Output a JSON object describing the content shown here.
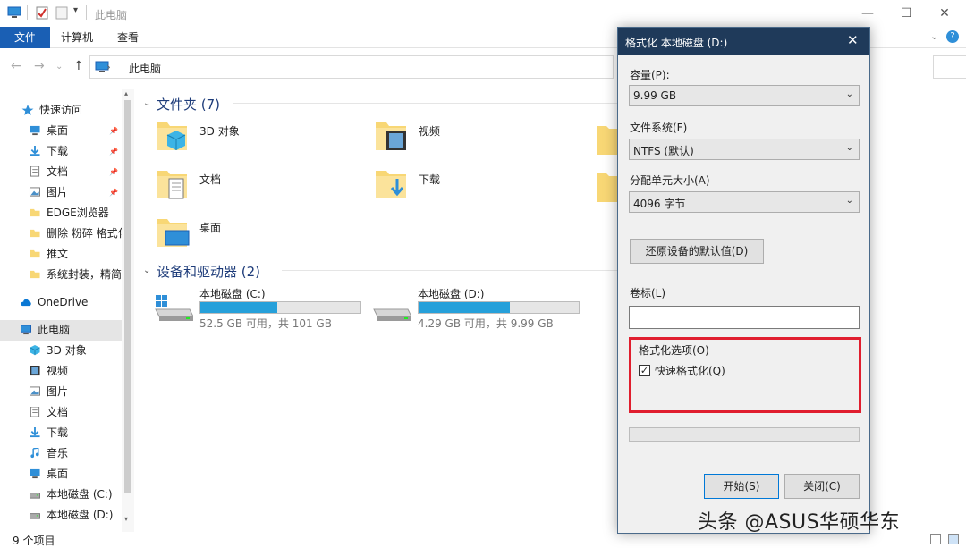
{
  "window": {
    "title": "此电脑",
    "ribbon_tabs": [
      "计算机",
      "查看"
    ],
    "file_tab": "文件"
  },
  "address": {
    "path": "此电脑"
  },
  "sidebar": {
    "quick_access": "快速访问",
    "quick_items": [
      {
        "label": "桌面",
        "icon": "desktop-icon",
        "pinned": true
      },
      {
        "label": "下载",
        "icon": "download-icon",
        "pinned": true
      },
      {
        "label": "文档",
        "icon": "document-icon",
        "pinned": true
      },
      {
        "label": "图片",
        "icon": "picture-icon",
        "pinned": true
      },
      {
        "label": "EDGE浏览器",
        "icon": "folder-icon",
        "pinned": false
      },
      {
        "label": "删除 粉碎 格式化",
        "icon": "folder-icon",
        "pinned": false
      },
      {
        "label": "推文",
        "icon": "folder-icon",
        "pinned": false
      },
      {
        "label": "系统封装，精简",
        "icon": "folder-icon",
        "pinned": false
      }
    ],
    "onedrive": "OneDrive",
    "this_pc": "此电脑",
    "pc_items": [
      {
        "label": "3D 对象",
        "icon": "3d-objects-icon"
      },
      {
        "label": "视频",
        "icon": "video-icon"
      },
      {
        "label": "图片",
        "icon": "picture-icon"
      },
      {
        "label": "文档",
        "icon": "document-icon"
      },
      {
        "label": "下载",
        "icon": "download-icon"
      },
      {
        "label": "音乐",
        "icon": "music-icon"
      },
      {
        "label": "桌面",
        "icon": "desktop-icon"
      },
      {
        "label": "本地磁盘 (C:)",
        "icon": "drive-icon"
      },
      {
        "label": "本地磁盘 (D:)",
        "icon": "drive-icon"
      }
    ]
  },
  "main": {
    "folders_title": "文件夹 (7)",
    "folders": [
      {
        "label": "3D 对象",
        "icon": "3d-objects-icon"
      },
      {
        "label": "视频",
        "icon": "video-icon"
      },
      {
        "label": "文档",
        "icon": "document-icon"
      },
      {
        "label": "下载",
        "icon": "download-icon"
      },
      {
        "label": "桌面",
        "icon": "desktop-icon"
      }
    ],
    "devices_title": "设备和驱动器 (2)",
    "drives": [
      {
        "label": "本地磁盘 (C:)",
        "sub": "52.5 GB 可用，共 101 GB",
        "used_fraction": 0.48,
        "icon": "windows-drive-icon"
      },
      {
        "label": "本地磁盘 (D:)",
        "sub": "4.29 GB 可用，共 9.99 GB",
        "used_fraction": 0.57,
        "icon": "drive-icon"
      }
    ]
  },
  "status": {
    "item_count": "9 个项目"
  },
  "dialog": {
    "title": "格式化 本地磁盘 (D:)",
    "capacity_label": "容量(P):",
    "capacity_value": "9.99 GB",
    "filesystem_label": "文件系统(F)",
    "filesystem_value": "NTFS (默认)",
    "alloc_label": "分配单元大小(A)",
    "alloc_value": "4096 字节",
    "restore_label": "还原设备的默认值(D)",
    "volume_label": "卷标(L)",
    "volume_value": "",
    "options_title": "格式化选项(O)",
    "quick_format_label": "快速格式化(Q)",
    "quick_format_checked": true,
    "start_label": "开始(S)",
    "close_label": "关闭(C)"
  },
  "watermark": "头条 @ASUS华硕华东",
  "colors": {
    "accent": "#1a5fb4",
    "drive_fill": "#26a0da",
    "highlight_box": "#e01e2e",
    "dialog_title": "#1f3a5a"
  }
}
